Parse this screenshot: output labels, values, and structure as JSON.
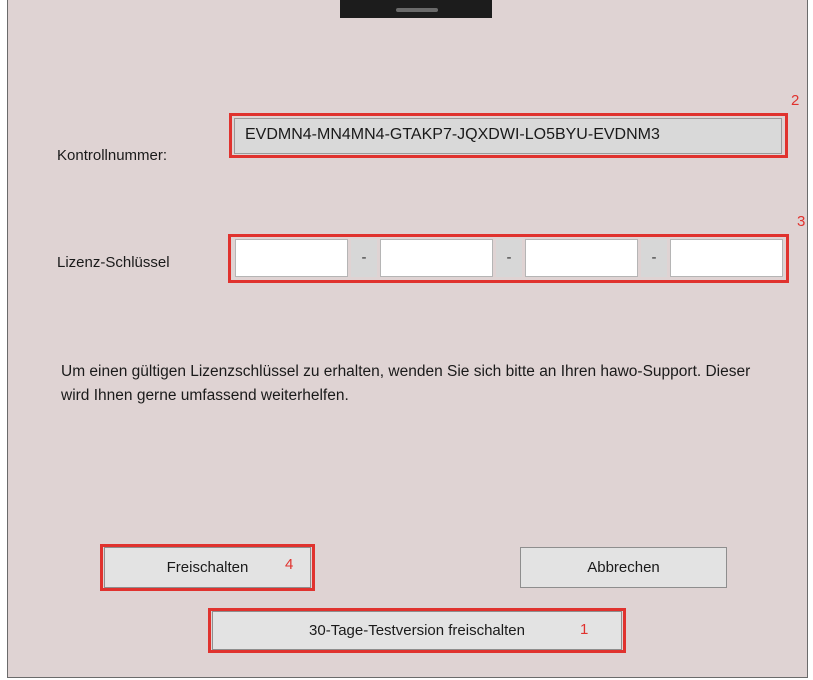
{
  "dialog": {
    "control_number_label": "Kontrollnummer:",
    "control_number_value": "EVDMN4-MN4MN4-GTAKP7-JQXDWI-LO5BYU-EVDNM3",
    "license_key_label": "Lizenz-Schlüssel",
    "license_key_segments": [
      "",
      "",
      "",
      ""
    ],
    "separator": "-",
    "info_text": "Um einen gültigen Lizenzschlüssel zu erhalten, wenden Sie sich bitte an Ihren hawo-Support. Dieser wird Ihnen gerne umfassend weiterhelfen.",
    "unlock_button": "Freischalten",
    "cancel_button": "Abbrechen",
    "trial_button": "30-Tage-Testversion freischalten"
  },
  "annotations": {
    "trial": "1",
    "control_number": "2",
    "license_key": "3",
    "unlock": "4",
    "color": "#e0322e"
  }
}
